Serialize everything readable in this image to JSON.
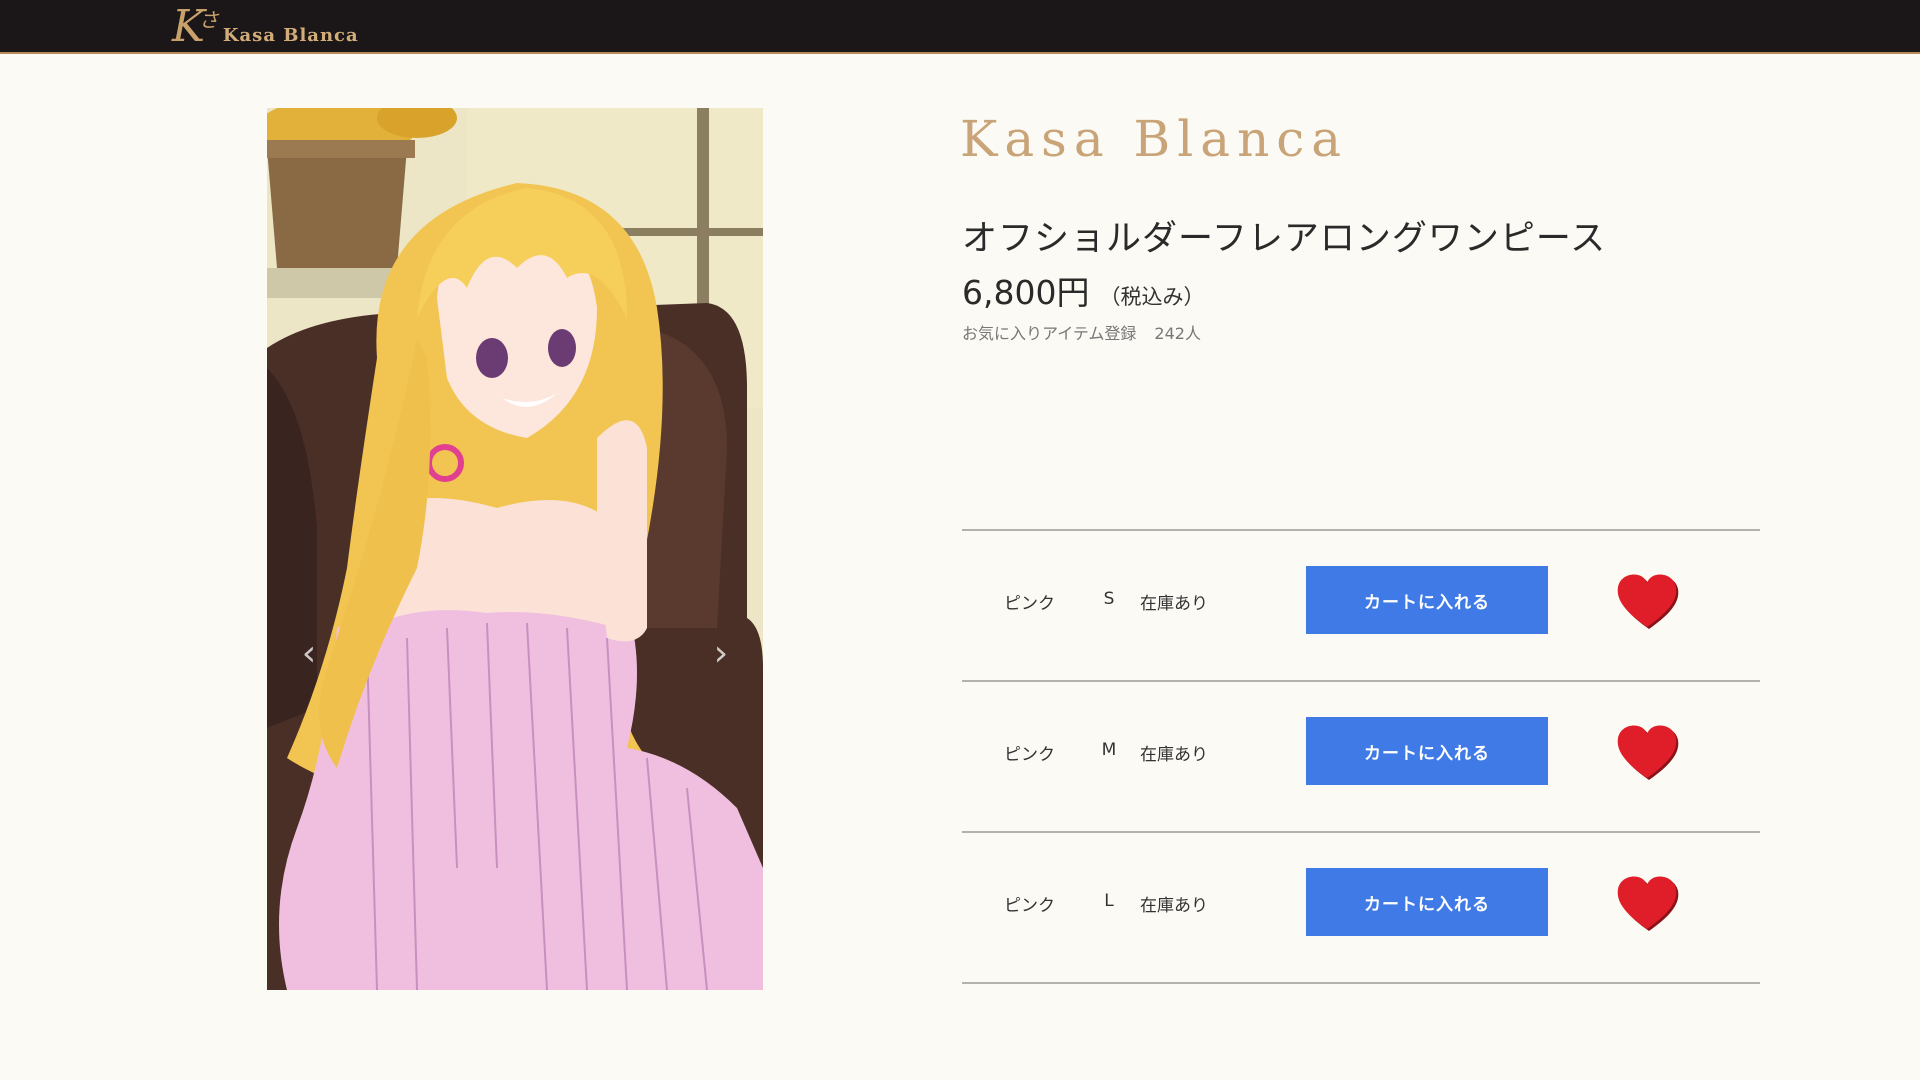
{
  "header": {
    "logo_mark": "K",
    "logo_mark_small": "さ",
    "logo_text": "Kasa Blanca"
  },
  "product": {
    "brand": "Kasa Blanca",
    "title": "オフショルダーフレアロングワンピース",
    "price": "6,800円",
    "tax_note": "（税込み）",
    "favorites_label": "お気に入りアイテム登録",
    "favorites_count": "242人",
    "image_alt": "anime girl in pink off-shoulder dress sitting on brown leather sofa"
  },
  "gallery": {
    "prev_icon": "chevron-left-icon",
    "next_icon": "chevron-right-icon",
    "prev_glyph": "‹",
    "next_glyph": "›"
  },
  "variants": [
    {
      "color": "ピンク",
      "size": "S",
      "stock": "在庫あり",
      "cart_label": "カートに入れる"
    },
    {
      "color": "ピンク",
      "size": "M",
      "stock": "在庫あり",
      "cart_label": "カートに入れる"
    },
    {
      "color": "ピンク",
      "size": "L",
      "stock": "在庫あり",
      "cart_label": "カートに入れる"
    }
  ],
  "colors": {
    "header_bg": "#1b1718",
    "brand_gold": "#c9a478",
    "cart_blue": "#3f7ae6",
    "heart_red": "#e01e2a"
  }
}
